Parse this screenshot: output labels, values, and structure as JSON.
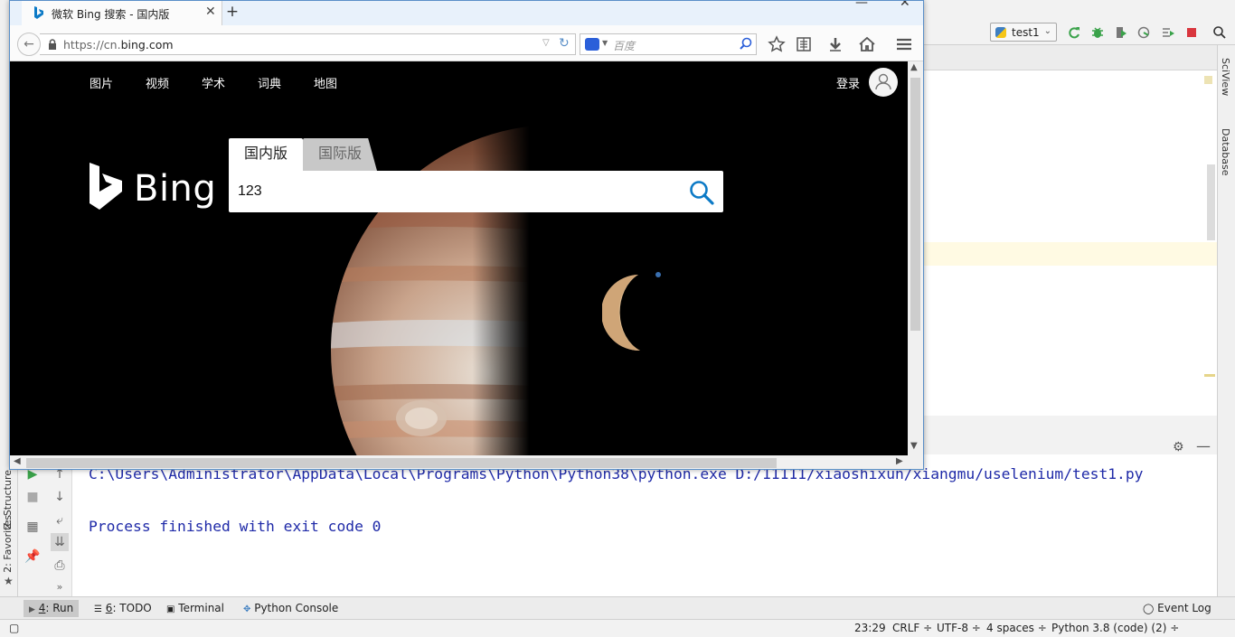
{
  "browser": {
    "tab_title": "微软 Bing 搜索 - 国内版",
    "new_tab_symbol": "+",
    "url_prefix": "https://cn.",
    "url_domain": "bing.com",
    "search_engine_placeholder": "百度"
  },
  "bing": {
    "nav": [
      "图片",
      "视频",
      "学术",
      "词典",
      "地图"
    ],
    "login": "登录",
    "logo_text": "Bing",
    "tabs": {
      "domestic": "国内版",
      "international": "国际版"
    },
    "query": "123"
  },
  "ide": {
    "run_config": "test1",
    "right_rail": [
      "SciView",
      "Database"
    ],
    "left_rail": [
      "Z: Structure",
      "2: Favorites"
    ],
    "console_lines": [
      "C:\\Users\\Administrator\\AppData\\Local\\Programs\\Python\\Python38\\python.exe D:/11111/xiaoshixun/xiangmu/uselenium/test1.py",
      "Process finished with exit code 0"
    ],
    "bottom_tabs": [
      {
        "num": "4",
        "label": ": Run"
      },
      {
        "num": "6",
        "label": ": TODO"
      },
      {
        "num": "",
        "label": "Terminal"
      },
      {
        "num": "",
        "label": "Python Console"
      }
    ],
    "event_log": "Event Log",
    "status": {
      "position": "23:29",
      "line_sep": "CRLF",
      "encoding": "UTF-8",
      "indent": "4 spaces",
      "interpreter": "Python 3.8 (code) (2)"
    }
  },
  "colors": {
    "console_text": "#1f2aa8",
    "caret_line": "#fffae3",
    "bing_accent": "#0c7ac6"
  }
}
